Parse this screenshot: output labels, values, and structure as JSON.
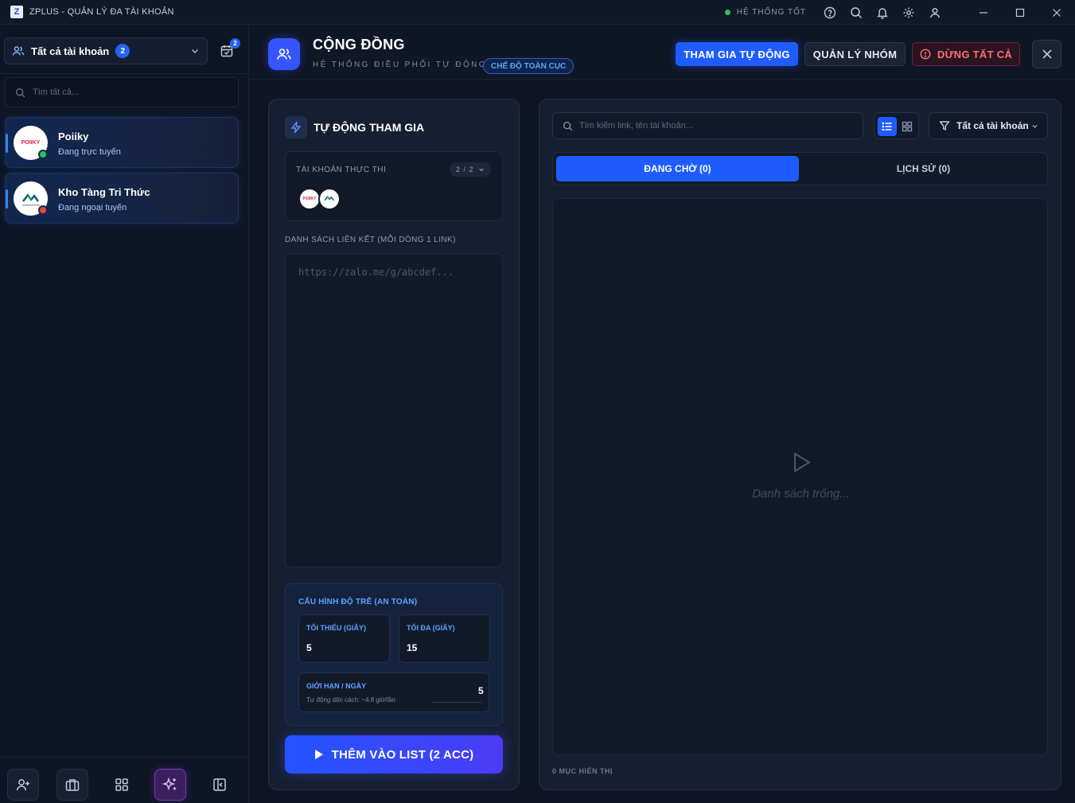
{
  "app": {
    "title": "ZPLUS - QUẢN LÝ ĐA TÀI KHOẢN",
    "logo_letter": "Z",
    "status_text": "HỆ THỐNG TỐT",
    "status_color": "#22c55e"
  },
  "sidebar": {
    "account_selector_label": "Tất cả tài khoản",
    "account_count": "2",
    "calendar_badge": "2",
    "search_placeholder": "Tìm tất cả...",
    "accounts": [
      {
        "name": "Poiiky",
        "status": "Đang trực tuyến",
        "online": true,
        "logo_text": "POIIKY"
      },
      {
        "name": "Kho Tàng Tri Thức",
        "status": "Đang ngoại tuyến",
        "online": false,
        "logo_text": "KHO TÀNG TRI THỨC"
      }
    ]
  },
  "header": {
    "title": "CỘNG ĐỒNG",
    "subtitle": "HỆ THỐNG ĐIỀU PHỐI TỰ ĐỘNG",
    "mode_pill": "CHẾ ĐỘ TOÀN CỤC",
    "btn_auto_join": "THAM GIA TỰ ĐỘNG",
    "btn_manage_groups": "QUẢN LÝ NHÓM",
    "btn_stop_all": "DỪNG TẤT CẢ"
  },
  "auto_join": {
    "title": "TỰ ĐỘNG THAM GIA",
    "exec_accounts_label": "TÀI KHOẢN THỰC THI",
    "exec_accounts_count": "2 / 2",
    "links_label": "DANH SÁCH LIÊN KẾT (MỖI DÒNG 1 LINK)",
    "links_placeholder": "https://zalo.me/g/abcdef...",
    "delay_title": "CẤU HÌNH ĐỘ TRỄ (AN TOÀN)",
    "min_label": "TỐI THIỂU (GIÂY)",
    "min_value": "5",
    "max_label": "TỐI ĐA (GIÂY)",
    "max_value": "15",
    "limit_label": "GIỚI HẠN / NGÀY",
    "limit_hint": "Tự động dãn cách: ~4.8 giờ/lần",
    "limit_value": "5",
    "add_button": "THÊM VÀO LIST (2 ACC)"
  },
  "queue": {
    "search_placeholder": "Tìm kiếm link, tên tài khoản...",
    "filter_label": "Tất cả tài khoản",
    "tab_pending": "ĐANG CHỜ (0)",
    "tab_history": "LỊCH SỬ (0)",
    "empty_text": "Danh sách trống...",
    "count_text": "0 MỤC HIỂN THỊ"
  },
  "colors": {
    "accent": "#1f5cff",
    "danger": "#f87171",
    "offline": "#ef4444",
    "online": "#22c55e"
  }
}
